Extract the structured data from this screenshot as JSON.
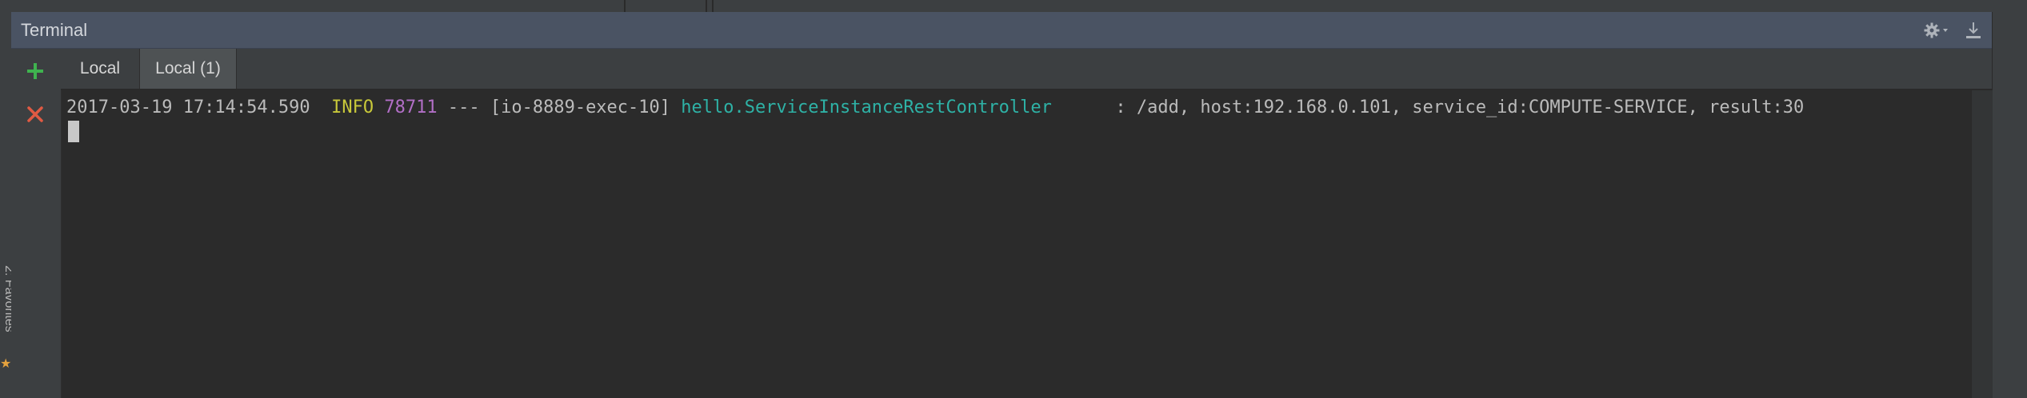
{
  "ide": {
    "favorites_label": "2: Favorites"
  },
  "terminal": {
    "title": "Terminal",
    "tabs": [
      {
        "label": "Local",
        "active": false
      },
      {
        "label": "Local (1)",
        "active": true
      }
    ],
    "toolbar": {
      "new_session_icon": "plus-icon",
      "close_session_icon": "close-icon"
    },
    "header_icons": [
      "gear-icon",
      "hide-panel-icon"
    ],
    "log": {
      "timestamp": "2017-03-19 17:14:54.590",
      "level": "INFO",
      "pid": "78711",
      "separator": "---",
      "thread": "[io-8889-exec-10]",
      "logger": "hello.ServiceInstanceRestController",
      "message": ": /add, host:192.168.0.101, service_id:COMPUTE-SERVICE, result:30"
    }
  },
  "colors": {
    "header_bg": "#4a5363",
    "console_bg": "#2b2b2b",
    "level_info": "#c8c83a",
    "pid": "#b26fc7",
    "logger": "#2eb2a6",
    "plus": "#3fb34f",
    "close": "#e05a43"
  }
}
